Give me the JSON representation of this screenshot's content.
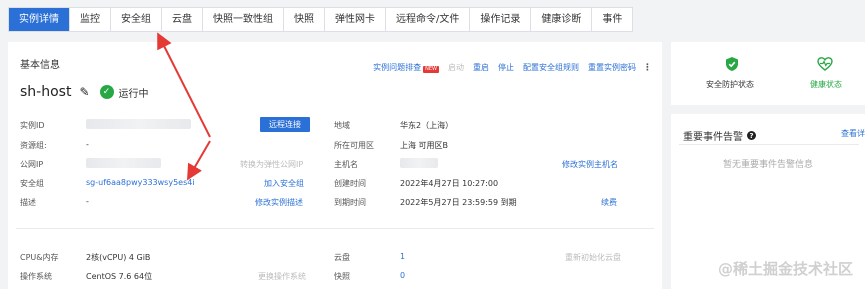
{
  "tabs": [
    "实例详情",
    "监控",
    "安全组",
    "云盘",
    "快照一致性组",
    "快照",
    "弹性网卡",
    "远程命令/文件",
    "操作记录",
    "健康诊断",
    "事件"
  ],
  "basic": {
    "title": "基本信息",
    "actions": {
      "diagnose": "实例问题排查",
      "diagnose_badge": "NEW",
      "start": "启动",
      "restart": "重启",
      "stop": "停止",
      "security_rules": "配置安全组规则",
      "reset_password": "重置实例密码"
    },
    "hostname": "sh-host",
    "status": "运行中",
    "remote_button": "远程连接",
    "left": {
      "instance_id_label": "实例ID",
      "resource_group_label": "资源组:",
      "resource_group_value": "-",
      "public_ip_label": "公网IP",
      "convert_eip": "转换为弹性公网IP",
      "security_group_label": "安全组",
      "security_group_value": "sg-uf6aa8pwy333wsy5es4i",
      "add_security_group": "加入安全组",
      "description_label": "描述",
      "description_value": "-",
      "edit_description": "修改实例描述"
    },
    "right": {
      "region_label": "地域",
      "region_value": "华东2（上海）",
      "zone_label": "所在可用区",
      "zone_value": "上海 可用区B",
      "hostname_label": "主机名",
      "edit_hostname": "修改实例主机名",
      "created_label": "创建时间",
      "created_value": "2022年4月27日 10:27:00",
      "expire_label": "到期时间",
      "expire_value": "2022年5月27日 23:59:59 到期",
      "renew": "续费"
    },
    "specs": {
      "cpu_label": "CPU&内存",
      "cpu_value": "2核(vCPU) 4 GiB",
      "os_label": "操作系统",
      "os_value": "CentOS 7.6 64位",
      "change_os": "更换操作系统",
      "disk_label": "云盘",
      "disk_value": "1",
      "reinit_disk": "重新初始化云盘",
      "snapshot_label": "快照",
      "snapshot_value": "0"
    }
  },
  "side": {
    "security_status": "安全防护状态",
    "health_status": "健康状态",
    "accent_green": "#27a844"
  },
  "events": {
    "title": "重要事件告警",
    "view_link": "查看详",
    "empty": "暂无重要事件告警信息"
  },
  "watermark": "@稀土掘金技术社区",
  "colors": {
    "accent": "#2b70d6",
    "annotation_arrow": "#e53935"
  }
}
